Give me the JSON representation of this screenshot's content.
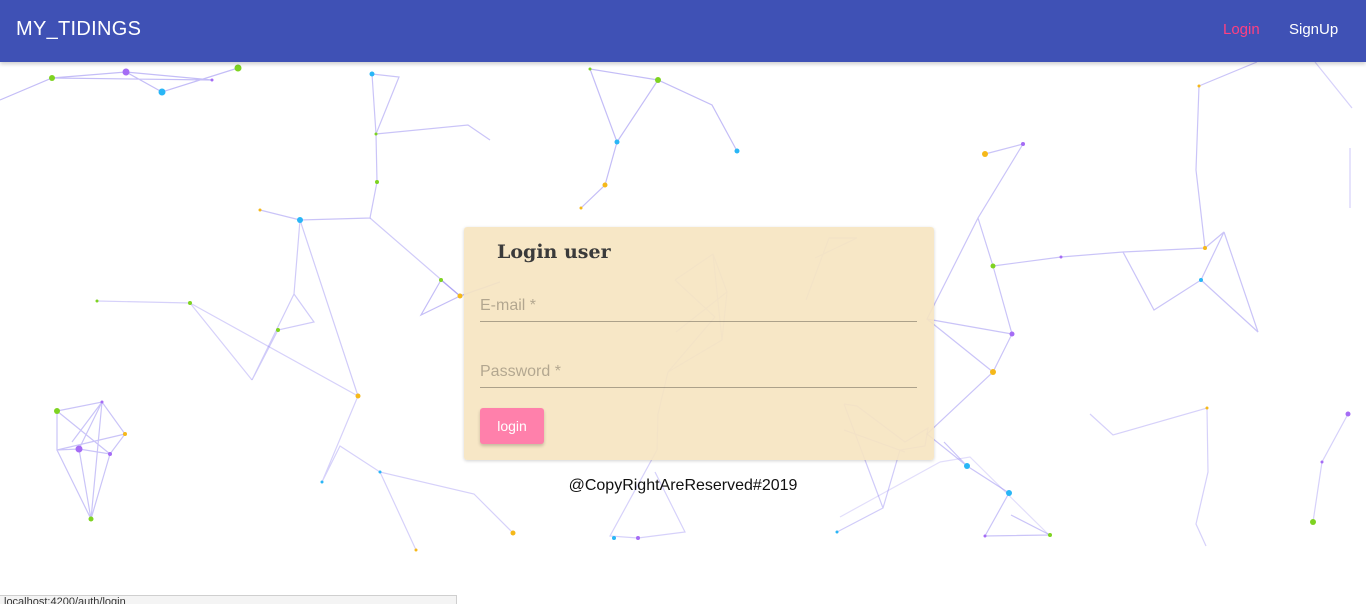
{
  "navbar": {
    "brand": "MY_TIDINGS",
    "login_label": "Login",
    "signup_label": "SignUp"
  },
  "login_card": {
    "title": "Login user",
    "email_placeholder": "E-mail *",
    "password_placeholder": "Password *",
    "submit_label": "login"
  },
  "footer": {
    "copyright": "@CopyRightAreReserved#2019"
  },
  "status_bar": {
    "url": "localhost:4200/auth/login"
  },
  "colors": {
    "navbar_bg": "#3f51b5",
    "nav_active": "#ff4081",
    "card_bg": "#f6e4c0",
    "button_bg": "#ff80ab",
    "node_colors": [
      "#7ed321",
      "#29b6f6",
      "#a56cf5",
      "#f5b81a"
    ]
  }
}
